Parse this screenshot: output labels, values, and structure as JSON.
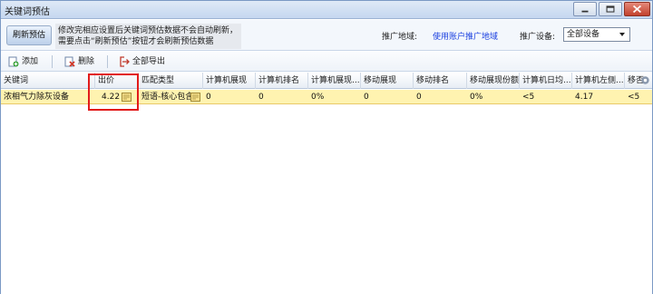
{
  "window": {
    "title": "关键词预估"
  },
  "top": {
    "refresh_label": "刷新预估",
    "hint_line1": "修改完相应设置后关键词预估数据不会自动刷新，",
    "hint_line2": "需要点击“刷新预估”按钮才会刷新预估数据",
    "region_label": "推广地域:",
    "region_link": "使用账户推广地域",
    "device_label": "推广设备:",
    "device_value": "全部设备"
  },
  "toolbar": {
    "add_label": "添加",
    "delete_label": "删除",
    "export_label": "全部导出"
  },
  "table": {
    "columns": [
      "关键词",
      "出价",
      "匹配类型",
      "计算机展现",
      "计算机排名",
      "计算机展现...",
      "移动展现",
      "移动排名",
      "移动展现份额",
      "计算机日均...",
      "计算机左侧...",
      "移否"
    ],
    "rows": [
      {
        "keyword": "浓相气力除灰设备",
        "bid": "4.22",
        "match": "短语-核心包含",
        "pc_impr": "0",
        "pc_rank": "0",
        "pc_share": "0%",
        "mobile_impr": "0",
        "mobile_rank": "0",
        "mobile_share": "0%",
        "pc_daily": "<5",
        "pc_left": "4.17",
        "last": "<5"
      }
    ]
  },
  "colors": {
    "highlight_box": "#e21b1b",
    "selected_row": "#fff3b0",
    "link": "#1a3fe0"
  },
  "icons": [
    "minimize-icon",
    "maximize-icon",
    "close-icon",
    "add-icon",
    "delete-icon",
    "export-icon",
    "note-icon",
    "settings-icon",
    "dropdown-arrow-icon"
  ]
}
